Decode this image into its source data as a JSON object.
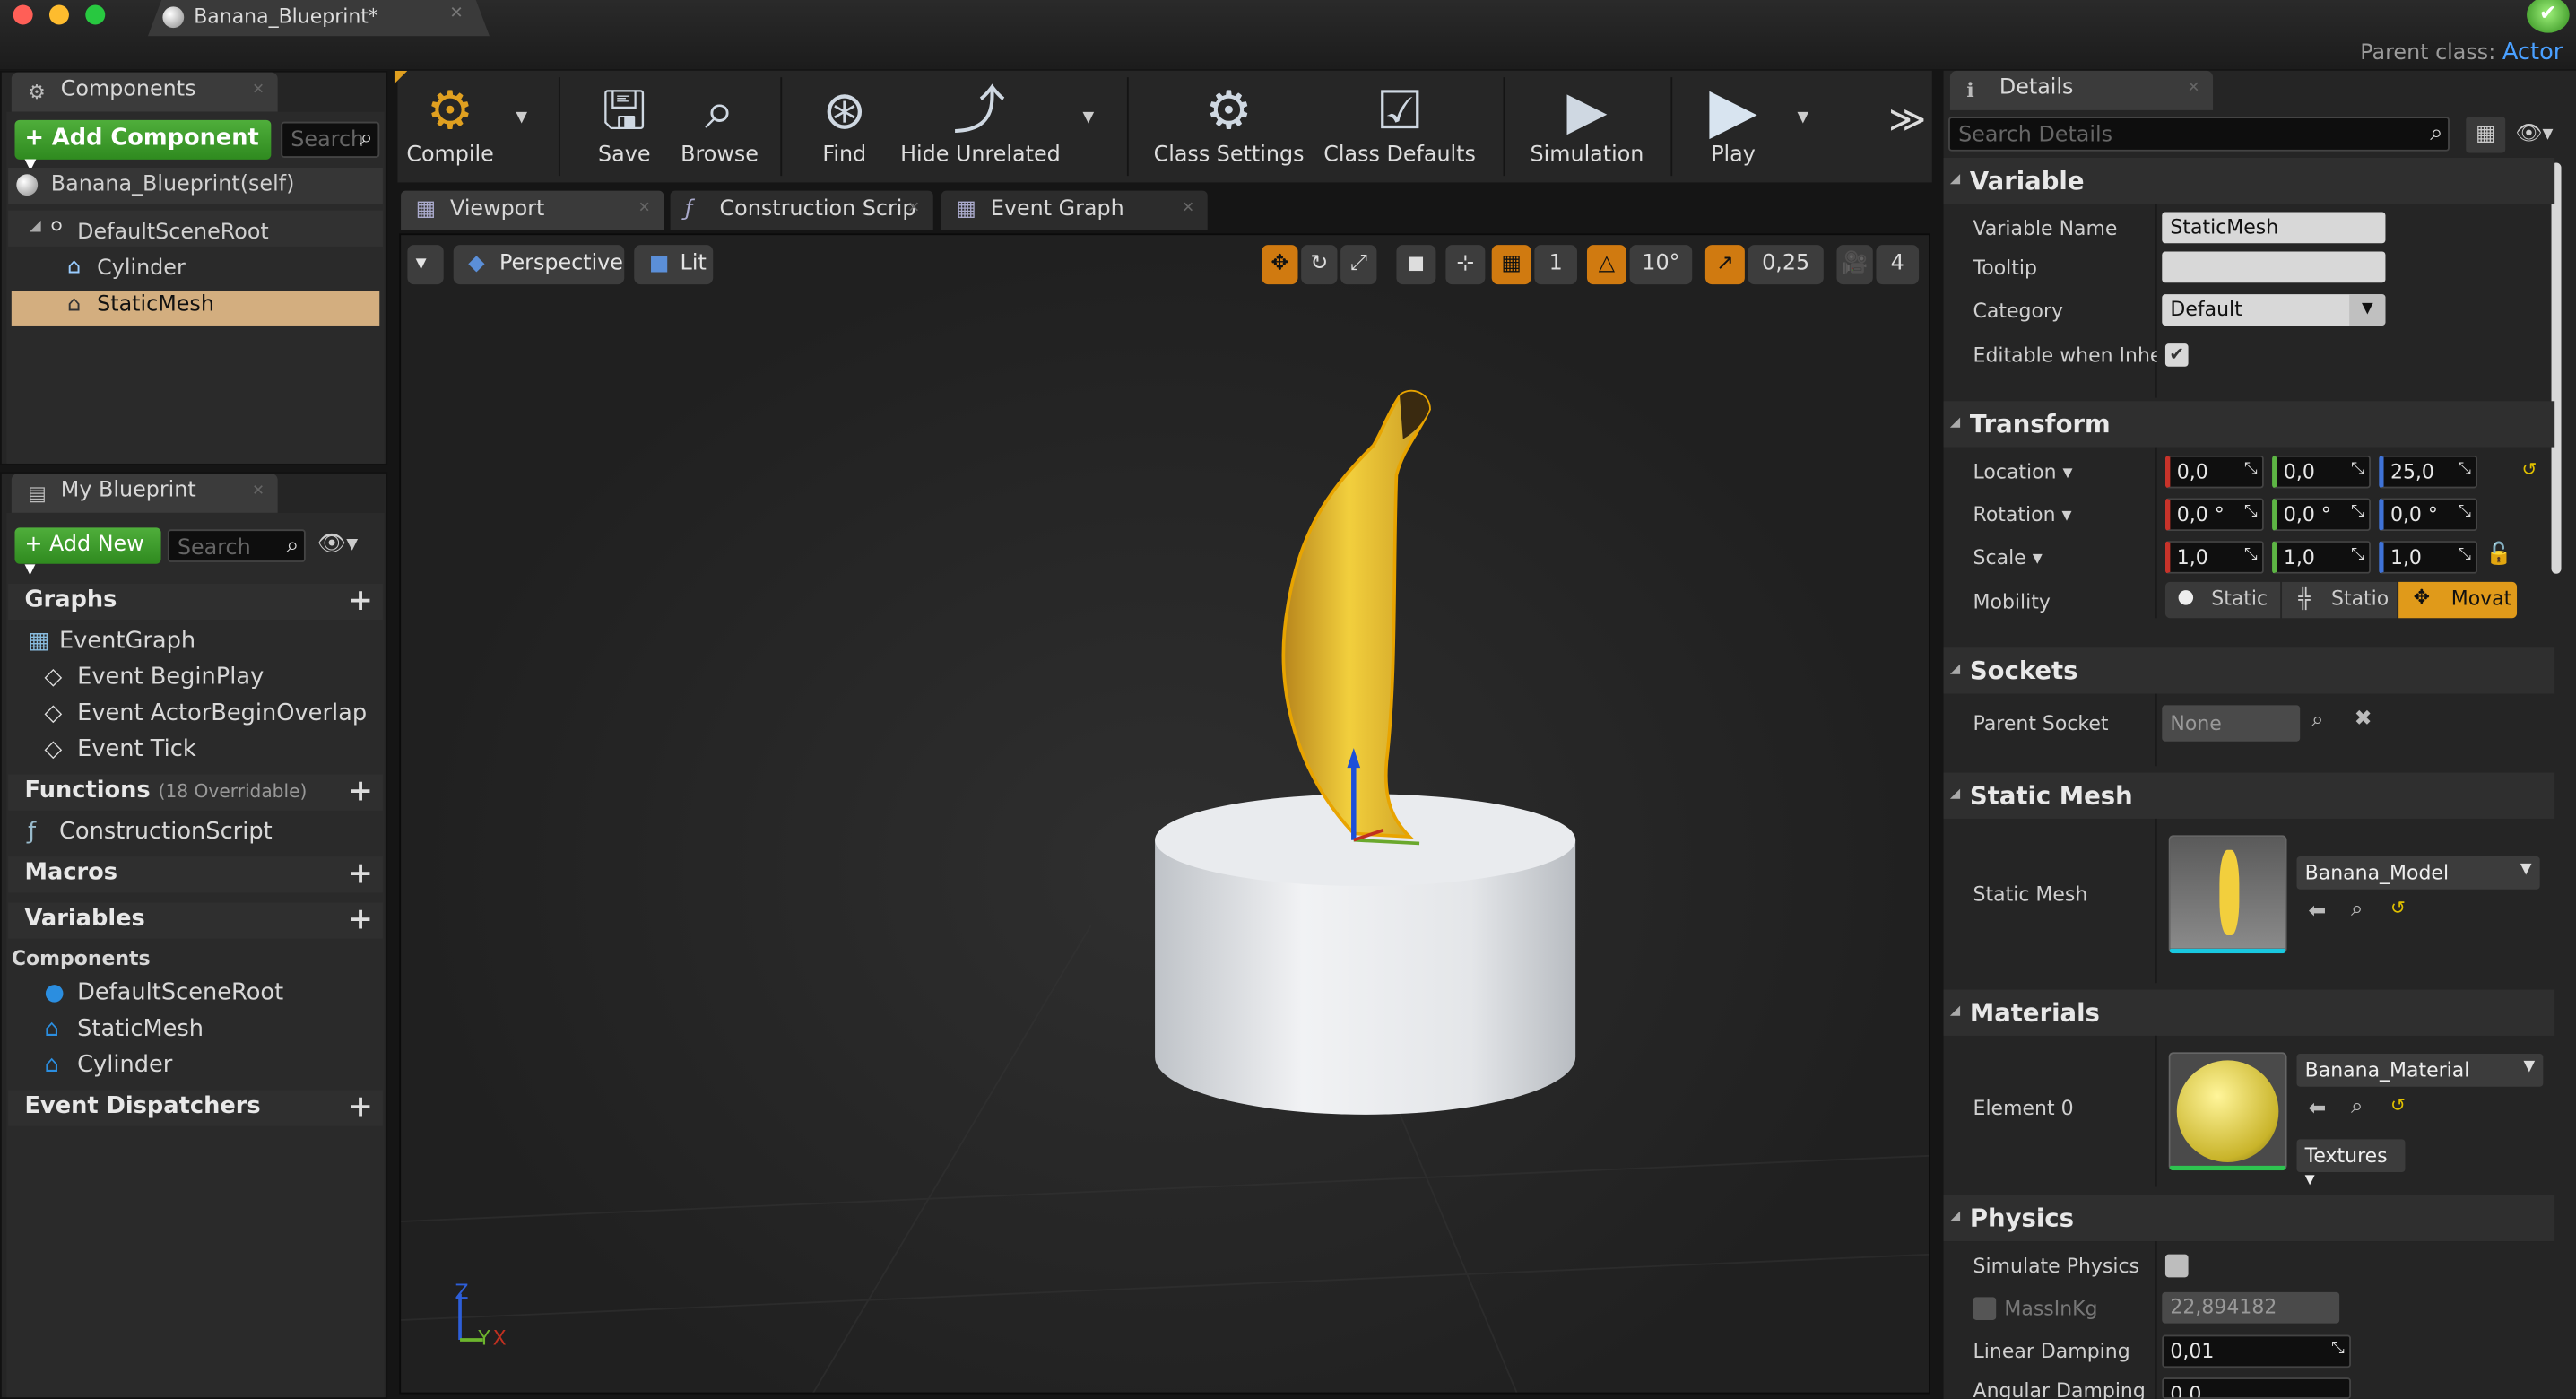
{
  "window": {
    "document_tab": "Banana_Blueprint*",
    "parent_class_label": "Parent class:",
    "parent_class_value": "Actor",
    "colors": {
      "close": "#ff5f57",
      "minimize": "#febc2e",
      "maximize": "#28c840",
      "accent": "#4aa0ff",
      "selection": "#d3ae7f"
    }
  },
  "components": {
    "tab_label": "Components",
    "add_component_label": "+ Add Component ▾",
    "search_placeholder": "Search",
    "self_item": "Banana_Blueprint(self)",
    "tree": [
      "DefaultSceneRoot",
      "Cylinder",
      "StaticMesh"
    ],
    "selected": "StaticMesh"
  },
  "my_blueprint": {
    "tab_label": "My Blueprint",
    "add_new_label": "+ Add New ▾",
    "search_placeholder": "Search",
    "graphs_header": "Graphs",
    "event_graph": "EventGraph",
    "events": [
      "Event BeginPlay",
      "Event ActorBeginOverlap",
      "Event Tick"
    ],
    "functions_header": "Functions",
    "functions_note": "(18 Overridable)",
    "construction_script": "ConstructionScript",
    "macros_header": "Macros",
    "variables_header": "Variables",
    "components_subheader": "Components",
    "component_vars": [
      "DefaultSceneRoot",
      "StaticMesh",
      "Cylinder"
    ],
    "dispatchers_header": "Event Dispatchers"
  },
  "toolbar": {
    "compile": "Compile",
    "save": "Save",
    "browse": "Browse",
    "find": "Find",
    "hide_unrelated": "Hide Unrelated",
    "class_settings": "Class Settings",
    "class_defaults": "Class Defaults",
    "simulation": "Simulation",
    "play": "Play",
    "overflow": "≫"
  },
  "editor_tabs": [
    "Viewport",
    "Construction Scrip",
    "Event Graph"
  ],
  "viewport": {
    "perspective": "Perspective",
    "lit": "Lit",
    "grid_snap": "1",
    "rotation_snap": "10°",
    "scale_snap": "0,25",
    "camera_speed": "4",
    "axis_z": "Z",
    "axis_y": "Y",
    "axis_x": "X"
  },
  "details": {
    "tab_label": "Details",
    "search_placeholder": "Search Details",
    "variable_header": "Variable",
    "variable_name_label": "Variable Name",
    "variable_name_value": "StaticMesh",
    "tooltip_label": "Tooltip",
    "tooltip_value": "",
    "category_label": "Category",
    "category_value": "Default",
    "editable_label": "Editable when Inherite",
    "transform_header": "Transform",
    "location_label": "Location ▾",
    "location": [
      "0,0",
      "0,0",
      "25,0"
    ],
    "rotation_label": "Rotation ▾",
    "rotation": [
      "0,0 °",
      "0,0 °",
      "0,0 °"
    ],
    "scale_label": "Scale ▾",
    "scale": [
      "1,0",
      "1,0",
      "1,0"
    ],
    "mobility_label": "Mobility",
    "mobility_options": [
      "Static",
      "Statio",
      "Movat"
    ],
    "mobility_selected": "Movat",
    "sockets_header": "Sockets",
    "parent_socket_label": "Parent Socket",
    "parent_socket_value": "None",
    "static_mesh_header": "Static Mesh",
    "static_mesh_label": "Static Mesh",
    "static_mesh_value": "Banana_Model",
    "materials_header": "Materials",
    "element0_label": "Element 0",
    "element0_value": "Banana_Material",
    "textures_label": "Textures ▾",
    "physics_header": "Physics",
    "simulate_physics_label": "Simulate Physics",
    "mass_label": "MassInKg",
    "mass_value": "22,894182",
    "linear_damping_label": "Linear Damping",
    "linear_damping_value": "0,01",
    "angular_damping_label": "Angular Damping",
    "angular_damping_value": "0,0"
  }
}
